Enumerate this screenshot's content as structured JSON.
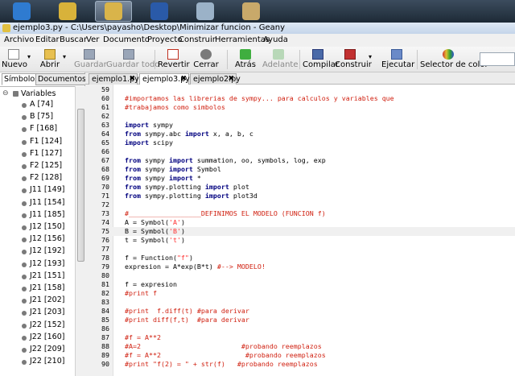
{
  "window": {
    "title": "ejemplo3.py - C:\\Users\\payasho\\Desktop\\Minimizar funcion - Geany"
  },
  "taskbar": {
    "items": [
      {
        "name": "windows-start-icon",
        "color": "#2f7bd0",
        "active": false
      },
      {
        "name": "chrome-icon",
        "color": "#d8b23a",
        "active": false
      },
      {
        "name": "geany-icon",
        "color": "#d9b44a",
        "active": true
      },
      {
        "name": "word-icon",
        "color": "#2a5aa8",
        "active": false
      },
      {
        "name": "file-manager-icon",
        "color": "#9bb2c8",
        "active": false
      },
      {
        "name": "paint-icon",
        "color": "#c8a96a",
        "active": false
      }
    ]
  },
  "menu": [
    "Archivo",
    "Editar",
    "Buscar",
    "Ver",
    "Documento",
    "Proyecto",
    "Construir",
    "Herramientas",
    "Ayuda"
  ],
  "toolbar": {
    "new": "Nuevo",
    "open": "Abrir",
    "save": "Guardar",
    "save_all": "Guardar todo",
    "revert": "Revertir",
    "close": "Cerrar",
    "back": "Atrás",
    "forward": "Adelante",
    "compile": "Compilar",
    "build": "Construir",
    "execute": "Ejecutar",
    "color_picker": "Selector de color",
    "dropdown_glyph": "▾"
  },
  "sidebar": {
    "tabs": [
      "Símbolos",
      "Documentos"
    ],
    "root": "Variables",
    "expander": "⊖",
    "symbols": [
      "A [74]",
      "B [75]",
      "F [168]",
      "F1 [124]",
      "F1 [127]",
      "F2 [125]",
      "F2 [128]",
      "J11 [149]",
      "J11 [154]",
      "J11 [185]",
      "J12 [150]",
      "J12 [156]",
      "J12 [192]",
      "J12 [193]",
      "J21 [151]",
      "J21 [158]",
      "J21 [202]",
      "J21 [203]",
      "J22 [152]",
      "J22 [160]",
      "J22 [209]",
      "J22 [210]"
    ]
  },
  "editor": {
    "tabs": [
      {
        "label": "ejemplo1.py",
        "active": false
      },
      {
        "label": "ejemplo3.py",
        "active": true
      },
      {
        "label": "ejemplo2.py",
        "active": false
      }
    ],
    "tab_close": "✖",
    "current_line": 75,
    "lines": [
      {
        "num": "59",
        "tokens": []
      },
      {
        "num": "60",
        "tokens": [
          {
            "t": "#importamos las librerias de sympy... para calculos y variables que",
            "k": "comment"
          }
        ]
      },
      {
        "num": "61",
        "tokens": [
          {
            "t": "#trabajamos como simbolos",
            "k": "comment"
          }
        ]
      },
      {
        "num": "62",
        "tokens": []
      },
      {
        "num": "63",
        "tokens": [
          {
            "t": "import",
            "k": "keyword"
          },
          {
            "t": " sympy",
            "k": "plain"
          }
        ]
      },
      {
        "num": "64",
        "tokens": [
          {
            "t": "from",
            "k": "keyword"
          },
          {
            "t": " sympy.abc ",
            "k": "plain"
          },
          {
            "t": "import",
            "k": "keyword"
          },
          {
            "t": " x, a, b, c",
            "k": "plain"
          }
        ]
      },
      {
        "num": "65",
        "tokens": [
          {
            "t": "import",
            "k": "keyword"
          },
          {
            "t": " scipy",
            "k": "plain"
          }
        ]
      },
      {
        "num": "66",
        "tokens": []
      },
      {
        "num": "67",
        "tokens": [
          {
            "t": "from",
            "k": "keyword"
          },
          {
            "t": " sympy ",
            "k": "plain"
          },
          {
            "t": "import",
            "k": "keyword"
          },
          {
            "t": " summation, oo, symbols, log, exp",
            "k": "plain"
          }
        ]
      },
      {
        "num": "68",
        "tokens": [
          {
            "t": "from",
            "k": "keyword"
          },
          {
            "t": " sympy ",
            "k": "plain"
          },
          {
            "t": "import",
            "k": "keyword"
          },
          {
            "t": " Symbol",
            "k": "plain"
          }
        ]
      },
      {
        "num": "69",
        "tokens": [
          {
            "t": "from",
            "k": "keyword"
          },
          {
            "t": " sympy ",
            "k": "plain"
          },
          {
            "t": "import",
            "k": "keyword"
          },
          {
            "t": " *",
            "k": "plain"
          }
        ]
      },
      {
        "num": "70",
        "tokens": [
          {
            "t": "from",
            "k": "keyword"
          },
          {
            "t": " sympy.plotting ",
            "k": "plain"
          },
          {
            "t": "import",
            "k": "keyword"
          },
          {
            "t": " plot",
            "k": "plain"
          }
        ]
      },
      {
        "num": "71",
        "tokens": [
          {
            "t": "from",
            "k": "keyword"
          },
          {
            "t": " sympy.plotting ",
            "k": "plain"
          },
          {
            "t": "import",
            "k": "keyword"
          },
          {
            "t": " plot3d",
            "k": "plain"
          }
        ]
      },
      {
        "num": "72",
        "tokens": []
      },
      {
        "num": "73",
        "tokens": [
          {
            "t": "#__________________DEFINIMOS EL MODELO (FUNCION f)",
            "k": "comment"
          }
        ]
      },
      {
        "num": "74",
        "tokens": [
          {
            "t": "A = Symbol(",
            "k": "plain"
          },
          {
            "t": "'A'",
            "k": "string"
          },
          {
            "t": ")",
            "k": "plain"
          }
        ]
      },
      {
        "num": "75",
        "tokens": [
          {
            "t": "B = Symbol(",
            "k": "plain"
          },
          {
            "t": "'B'",
            "k": "string"
          },
          {
            "t": ")",
            "k": "plain"
          }
        ]
      },
      {
        "num": "76",
        "tokens": [
          {
            "t": "t = Symbol(",
            "k": "plain"
          },
          {
            "t": "'t'",
            "k": "string"
          },
          {
            "t": ")",
            "k": "plain"
          }
        ]
      },
      {
        "num": "77",
        "tokens": []
      },
      {
        "num": "78",
        "tokens": [
          {
            "t": "f = Function(",
            "k": "plain"
          },
          {
            "t": "\"f\"",
            "k": "string"
          },
          {
            "t": ")",
            "k": "plain"
          }
        ]
      },
      {
        "num": "79",
        "tokens": [
          {
            "t": "expresion = A*exp(B*t) ",
            "k": "plain"
          },
          {
            "t": "#--> MODELO!",
            "k": "comment"
          }
        ]
      },
      {
        "num": "80",
        "tokens": []
      },
      {
        "num": "81",
        "tokens": [
          {
            "t": "f = expresion",
            "k": "plain"
          }
        ]
      },
      {
        "num": "82",
        "tokens": [
          {
            "t": "#print f",
            "k": "comment"
          }
        ]
      },
      {
        "num": "83",
        "tokens": []
      },
      {
        "num": "84",
        "tokens": [
          {
            "t": "#print  f.diff(t) #para derivar",
            "k": "comment"
          }
        ]
      },
      {
        "num": "85",
        "tokens": [
          {
            "t": "#print diff(f,t)  #para derivar",
            "k": "comment"
          }
        ]
      },
      {
        "num": "86",
        "tokens": []
      },
      {
        "num": "87",
        "tokens": [
          {
            "t": "#f = A**2",
            "k": "comment"
          }
        ]
      },
      {
        "num": "88",
        "tokens": [
          {
            "t": "#A=2                         #probando reemplazos",
            "k": "comment"
          }
        ]
      },
      {
        "num": "89",
        "tokens": [
          {
            "t": "#f = A**2                     #probando reemplazos",
            "k": "comment"
          }
        ]
      },
      {
        "num": "90",
        "tokens": [
          {
            "t": "#print \"f(2) = \" + str(f)   #probando reemplazos",
            "k": "comment"
          }
        ]
      }
    ]
  }
}
